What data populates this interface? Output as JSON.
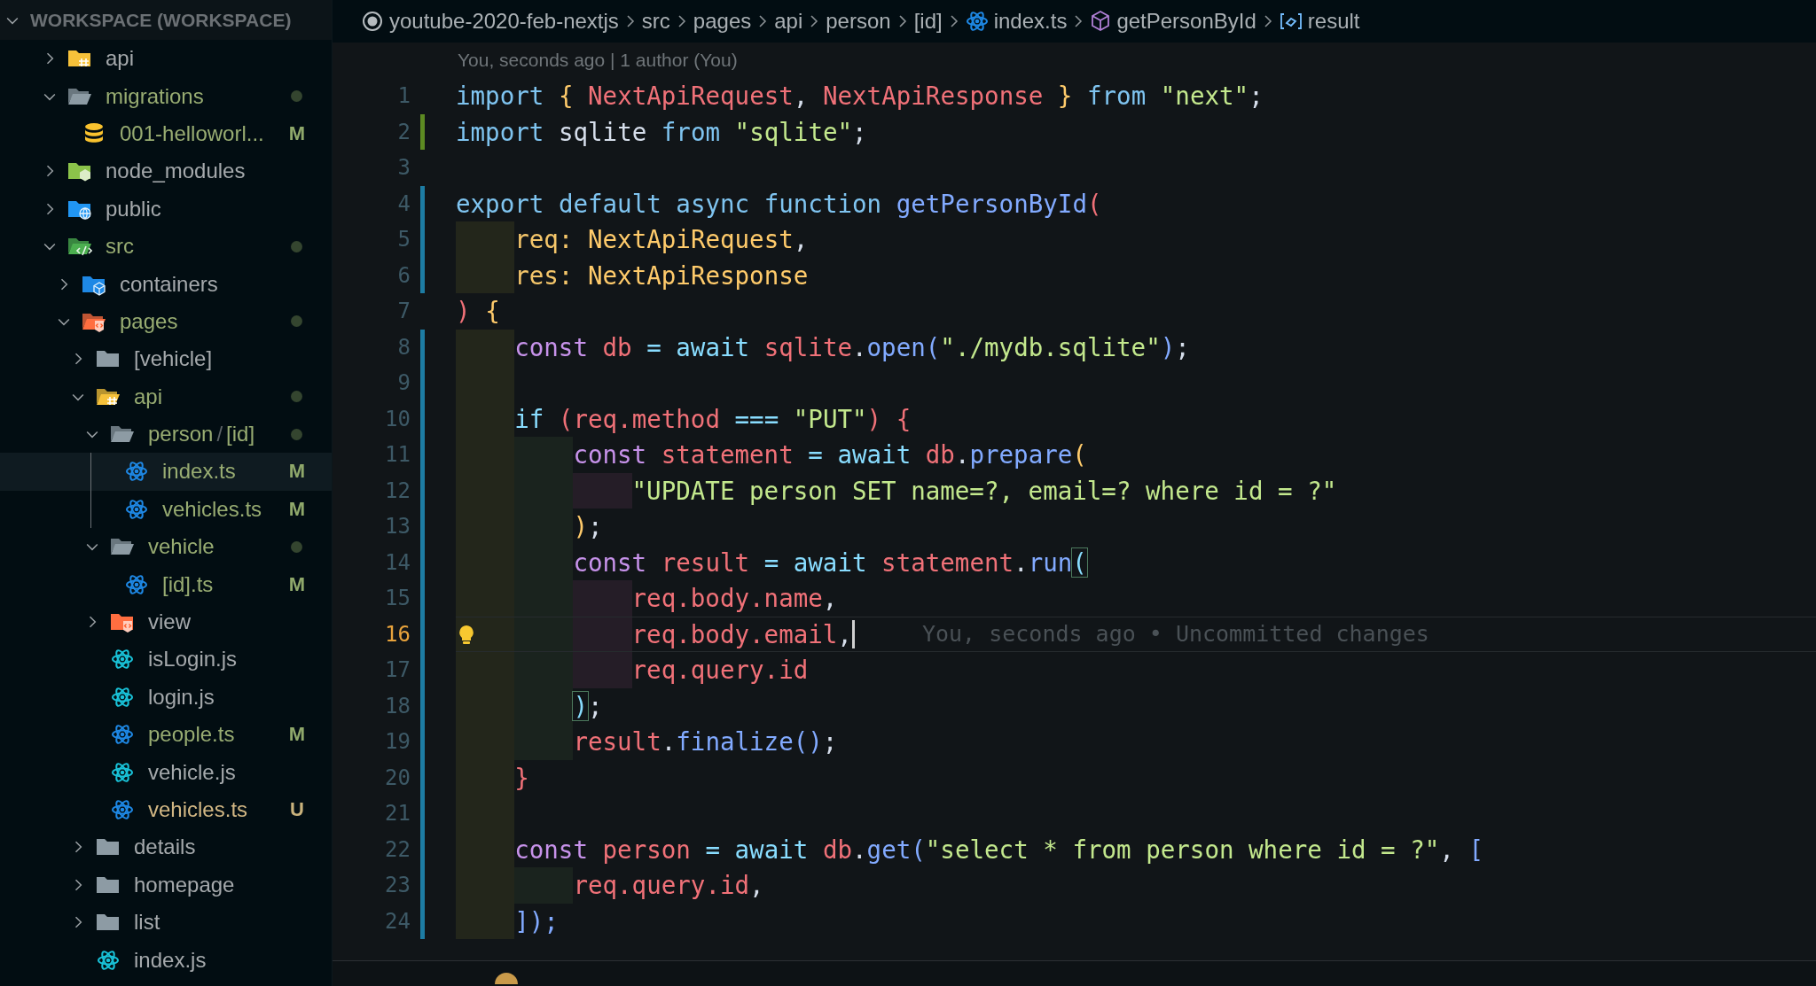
{
  "sidebar": {
    "title": "WORKSPACE (WORKSPACE)",
    "expanded": true,
    "tree": [
      {
        "name": "api",
        "kind": "folder-api",
        "expanded": false,
        "modified": false,
        "untracked": false,
        "selected": false
      },
      {
        "name": "migrations",
        "kind": "folder-plain",
        "expanded": true,
        "modified": true,
        "untracked": false,
        "selected": false,
        "children": [
          {
            "name": "001-helloworl...",
            "kind": "file-database",
            "modified": true,
            "untracked": false,
            "badge": "M",
            "selected": false
          }
        ]
      },
      {
        "name": "node_modules",
        "kind": "folder-node",
        "expanded": false,
        "modified": false,
        "untracked": false,
        "selected": false
      },
      {
        "name": "public",
        "kind": "folder-public",
        "expanded": false,
        "modified": false,
        "untracked": false,
        "selected": false
      },
      {
        "name": "src",
        "kind": "folder-src",
        "expanded": true,
        "modified": true,
        "untracked": false,
        "selected": false,
        "children": [
          {
            "name": "containers",
            "kind": "folder-cube",
            "expanded": false,
            "modified": false,
            "untracked": false,
            "selected": false
          },
          {
            "name": "pages",
            "kind": "folder-pages",
            "expanded": true,
            "modified": true,
            "untracked": false,
            "selected": false,
            "children": [
              {
                "name": "[vehicle]",
                "kind": "folder-plain",
                "expanded": false,
                "modified": false,
                "untracked": false,
                "selected": false
              },
              {
                "name": "api",
                "kind": "folder-api",
                "expanded": true,
                "modified": true,
                "untracked": false,
                "selected": false,
                "children": [
                  {
                    "segments": [
                      "person",
                      "/",
                      "[id]"
                    ],
                    "kind": "folder-plain",
                    "expanded": true,
                    "modified": true,
                    "untracked": false,
                    "selected": false,
                    "children": [
                      {
                        "name": "index.ts",
                        "kind": "file-react",
                        "modified": true,
                        "untracked": false,
                        "badge": "M",
                        "selected": true
                      },
                      {
                        "name": "vehicles.ts",
                        "kind": "file-react",
                        "modified": true,
                        "untracked": false,
                        "badge": "M",
                        "selected": false
                      }
                    ]
                  },
                  {
                    "name": "vehicle",
                    "kind": "folder-plain",
                    "expanded": true,
                    "modified": true,
                    "untracked": false,
                    "selected": false,
                    "children": [
                      {
                        "name": "[id].ts",
                        "kind": "file-react",
                        "modified": true,
                        "untracked": false,
                        "badge": "M",
                        "selected": false
                      }
                    ]
                  },
                  {
                    "name": "view",
                    "kind": "folder-pages",
                    "expanded": false,
                    "modified": false,
                    "untracked": false,
                    "selected": false
                  },
                  {
                    "name": "isLogin.js",
                    "kind": "file-react-js",
                    "modified": false,
                    "untracked": false,
                    "selected": false
                  },
                  {
                    "name": "login.js",
                    "kind": "file-react-js",
                    "modified": false,
                    "untracked": false,
                    "selected": false
                  },
                  {
                    "name": "people.ts",
                    "kind": "file-react",
                    "modified": true,
                    "untracked": false,
                    "badge": "M",
                    "selected": false
                  },
                  {
                    "name": "vehicle.js",
                    "kind": "file-react-js",
                    "modified": false,
                    "untracked": false,
                    "selected": false
                  },
                  {
                    "name": "vehicles.ts",
                    "kind": "file-react",
                    "modified": false,
                    "untracked": true,
                    "badge": "U",
                    "selected": false
                  }
                ]
              },
              {
                "name": "details",
                "kind": "folder-plain",
                "expanded": false,
                "modified": false,
                "untracked": false,
                "selected": false
              },
              {
                "name": "homepage",
                "kind": "folder-plain",
                "expanded": false,
                "modified": false,
                "untracked": false,
                "selected": false
              },
              {
                "name": "list",
                "kind": "folder-plain",
                "expanded": false,
                "modified": false,
                "untracked": false,
                "selected": false
              },
              {
                "name": "index.js",
                "kind": "file-react-js",
                "modified": false,
                "untracked": false,
                "selected": false
              }
            ]
          }
        ]
      }
    ]
  },
  "breadcrumbs": [
    {
      "label": "youtube-2020-feb-nextjs",
      "kind": "circle"
    },
    {
      "label": "src",
      "kind": "plain"
    },
    {
      "label": "pages",
      "kind": "plain"
    },
    {
      "label": "api",
      "kind": "plain"
    },
    {
      "label": "person",
      "kind": "plain"
    },
    {
      "label": "[id]",
      "kind": "plain"
    },
    {
      "label": "index.ts",
      "kind": "react"
    },
    {
      "label": "getPersonById",
      "kind": "method"
    },
    {
      "label": "result",
      "kind": "variable"
    }
  ],
  "codelens": "You, seconds ago | 1 author (You)",
  "lines": [
    {
      "number": "1",
      "added": false,
      "modified": false,
      "tokens": [
        {
          "kind": "kw",
          "text": "import "
        },
        {
          "kind": "b2",
          "text": "{ "
        },
        {
          "kind": "name",
          "text": "NextApiRequest"
        },
        {
          "kind": "plain",
          "text": ", "
        },
        {
          "kind": "name",
          "text": "NextApiResponse"
        },
        {
          "kind": "b2",
          "text": " } "
        },
        {
          "kind": "kw",
          "text": "from "
        },
        {
          "kind": "str",
          "text": "\"next\""
        },
        {
          "kind": "plain",
          "text": ";"
        }
      ]
    },
    {
      "number": "2",
      "added": true,
      "modified": false,
      "tokens": [
        {
          "kind": "kw",
          "text": "import "
        },
        {
          "kind": "plain",
          "text": "sqlite "
        },
        {
          "kind": "kw",
          "text": "from "
        },
        {
          "kind": "str",
          "text": "\"sqlite\""
        },
        {
          "kind": "plain",
          "text": ";"
        }
      ]
    },
    {
      "number": "3",
      "added": false,
      "modified": false
    },
    {
      "number": "4",
      "added": false,
      "modified": true,
      "tokens": [
        {
          "kind": "kw",
          "text": "export default async function "
        },
        {
          "kind": "fn",
          "text": "getPersonById"
        },
        {
          "kind": "b1",
          "text": "("
        }
      ],
      "children": [
        {
          "number": "5",
          "added": false,
          "modified": true,
          "tokens": [
            {
              "kind": "param",
              "text": "req: "
            },
            {
              "kind": "type",
              "text": "NextApiRequest"
            },
            {
              "kind": "plain",
              "text": ","
            }
          ]
        },
        {
          "number": "6",
          "added": false,
          "modified": true,
          "tokens": [
            {
              "kind": "param",
              "text": "res: "
            },
            {
              "kind": "type",
              "text": "NextApiResponse"
            }
          ]
        }
      ]
    },
    {
      "number": "7",
      "added": false,
      "modified": false,
      "tokens": [
        {
          "kind": "b1",
          "text": ") "
        },
        {
          "kind": "b2",
          "text": "{"
        }
      ],
      "children": [
        {
          "number": "8",
          "added": false,
          "modified": true,
          "tokens": [
            {
              "kind": "stor",
              "text": "const "
            },
            {
              "kind": "name",
              "text": "db "
            },
            {
              "kind": "op",
              "text": "= await "
            },
            {
              "kind": "name",
              "text": "sqlite"
            },
            {
              "kind": "plain",
              "text": "."
            },
            {
              "kind": "fn",
              "text": "open"
            },
            {
              "kind": "b3",
              "text": "("
            },
            {
              "kind": "str",
              "text": "\"./mydb.sqlite\""
            },
            {
              "kind": "b3",
              "text": ")"
            },
            {
              "kind": "plain",
              "text": ";"
            }
          ]
        },
        {
          "number": "9",
          "added": false,
          "modified": true
        },
        {
          "number": "10",
          "added": false,
          "modified": true,
          "tokens": [
            {
              "kind": "op",
              "text": "if "
            },
            {
              "kind": "b1",
              "text": "("
            },
            {
              "kind": "name",
              "text": "req.method "
            },
            {
              "kind": "op",
              "text": "=== "
            },
            {
              "kind": "str",
              "text": "\"PUT\""
            },
            {
              "kind": "b1",
              "text": ") {"
            }
          ],
          "children": [
            {
              "number": "11",
              "added": false,
              "modified": true,
              "tokens": [
                {
                  "kind": "stor",
                  "text": "const "
                },
                {
                  "kind": "name",
                  "text": "statement "
                },
                {
                  "kind": "op",
                  "text": "= await "
                },
                {
                  "kind": "name",
                  "text": "db"
                },
                {
                  "kind": "plain",
                  "text": "."
                },
                {
                  "kind": "fn",
                  "text": "prepare"
                },
                {
                  "kind": "b2",
                  "text": "("
                }
              ],
              "children": [
                {
                  "number": "12",
                  "added": false,
                  "modified": true,
                  "tokens": [
                    {
                      "kind": "str",
                      "text": "\"UPDATE person SET name=?, email=? where id = ?\""
                    }
                  ]
                }
              ]
            },
            {
              "number": "13",
              "added": false,
              "modified": true,
              "tokens": [
                {
                  "kind": "b2",
                  "text": ")"
                },
                {
                  "kind": "plain",
                  "text": ";"
                }
              ]
            },
            {
              "number": "14",
              "added": false,
              "modified": true,
              "tokens": [
                {
                  "kind": "stor",
                  "text": "const "
                },
                {
                  "kind": "name",
                  "text": "result "
                },
                {
                  "kind": "op",
                  "text": "= await "
                },
                {
                  "kind": "name",
                  "text": "statement"
                },
                {
                  "kind": "plain",
                  "text": "."
                },
                {
                  "kind": "fn",
                  "text": "run"
                },
                {
                  "kind": "match",
                  "text": "("
                }
              ],
              "children": [
                {
                  "number": "15",
                  "added": false,
                  "modified": true,
                  "tokens": [
                    {
                      "kind": "name",
                      "text": "req.body.name"
                    },
                    {
                      "kind": "plain",
                      "text": ","
                    }
                  ]
                },
                {
                  "number": "16",
                  "added": false,
                  "modified": true,
                  "current": true,
                  "cursor": true,
                  "lightbulb": true,
                  "blame": "You, seconds ago • Uncommitted changes",
                  "tokens": [
                    {
                      "kind": "name",
                      "text": "req.body.email"
                    },
                    {
                      "kind": "plain",
                      "text": ","
                    }
                  ]
                },
                {
                  "number": "17",
                  "added": false,
                  "modified": true,
                  "tokens": [
                    {
                      "kind": "name",
                      "text": "req.query.id"
                    }
                  ]
                }
              ]
            },
            {
              "number": "18",
              "added": false,
              "modified": true,
              "tokens": [
                {
                  "kind": "match",
                  "text": ")"
                },
                {
                  "kind": "plain",
                  "text": ";"
                }
              ]
            },
            {
              "number": "19",
              "added": false,
              "modified": true,
              "tokens": [
                {
                  "kind": "name",
                  "text": "result"
                },
                {
                  "kind": "plain",
                  "text": "."
                },
                {
                  "kind": "fn",
                  "text": "finalize"
                },
                {
                  "kind": "b3",
                  "text": "()"
                },
                {
                  "kind": "plain",
                  "text": ";"
                }
              ]
            }
          ]
        },
        {
          "number": "20",
          "added": false,
          "modified": true,
          "tokens": [
            {
              "kind": "b1",
              "text": "}"
            }
          ]
        },
        {
          "number": "21",
          "added": false,
          "modified": true
        },
        {
          "number": "22",
          "added": false,
          "modified": true,
          "tokens": [
            {
              "kind": "stor",
              "text": "const "
            },
            {
              "kind": "name",
              "text": "person "
            },
            {
              "kind": "op",
              "text": "= await "
            },
            {
              "kind": "name",
              "text": "db"
            },
            {
              "kind": "plain",
              "text": "."
            },
            {
              "kind": "fn",
              "text": "get"
            },
            {
              "kind": "b3",
              "text": "("
            },
            {
              "kind": "str",
              "text": "\"select * from person where id = ?\""
            },
            {
              "kind": "plain",
              "text": ", "
            },
            {
              "kind": "b3",
              "text": "["
            }
          ],
          "children": [
            {
              "number": "23",
              "added": false,
              "modified": true,
              "tokens": [
                {
                  "kind": "name",
                  "text": "req.query.id"
                },
                {
                  "kind": "plain",
                  "text": ","
                }
              ]
            }
          ]
        },
        {
          "number": "24",
          "added": false,
          "modified": true,
          "tokens": [
            {
              "kind": "b3",
              "text": "]);"
            }
          ]
        }
      ]
    }
  ]
}
